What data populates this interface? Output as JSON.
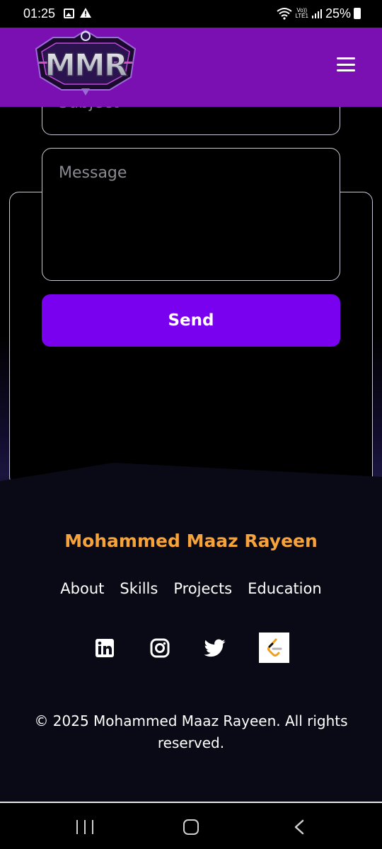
{
  "status_bar": {
    "time": "01:25",
    "volte_top": "Vo))",
    "volte_bottom": "LTE1",
    "battery": "25%"
  },
  "header": {
    "logo_text": "MMR",
    "menu_icon": "hamburger-menu-icon"
  },
  "contact_form": {
    "subject_placeholder": "Subject",
    "message_placeholder": "Message",
    "send_label": "Send"
  },
  "footer": {
    "name": "Mohammed Maaz Rayeen",
    "nav": [
      "About",
      "Skills",
      "Projects",
      "Education"
    ],
    "socials": [
      "linkedin-icon",
      "instagram-icon",
      "twitter-icon",
      "leetcode-icon"
    ],
    "copyright": "© 2025 Mohammed Maaz Rayeen. All rights reserved."
  },
  "colors": {
    "header_bg": "#7a0fb2",
    "send_button": "#7a00f0",
    "footer_name": "#f5a33a",
    "footer_bg": "#0a0a16"
  }
}
